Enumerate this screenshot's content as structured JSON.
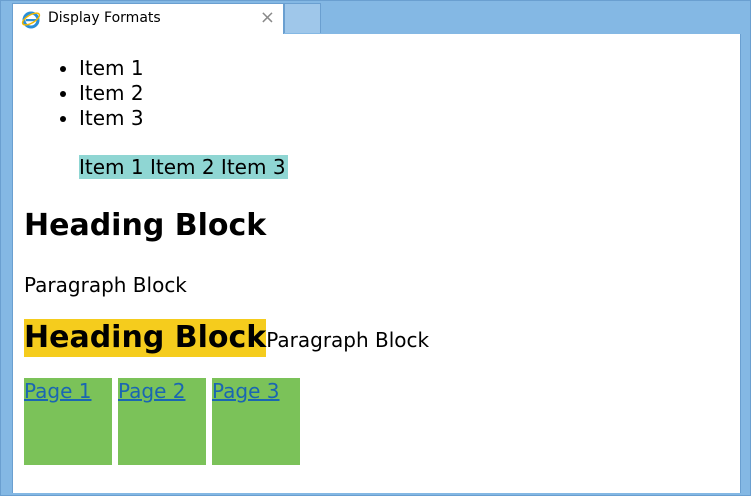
{
  "browser": {
    "tab_title": "Display Formats",
    "tab_close": "×",
    "tab_icon": "ie-icon"
  },
  "list": {
    "items": [
      "Item 1",
      "Item 2",
      "Item 3"
    ],
    "inline_text": "Item 1 Item 2 Item 3"
  },
  "blocks": {
    "heading": "Heading Block",
    "paragraph": "Paragraph Block",
    "inline_heading": "Heading Block",
    "inline_paragraph": "Paragraph Block"
  },
  "pages": {
    "links": [
      "Page 1",
      "Page 2",
      "Page 3"
    ]
  },
  "colors": {
    "inline_list_bg": "#8fd6d3",
    "inline_heading_bg": "#f5cc1d",
    "page_box_bg": "#7bc259",
    "link": "#1a66b2"
  }
}
